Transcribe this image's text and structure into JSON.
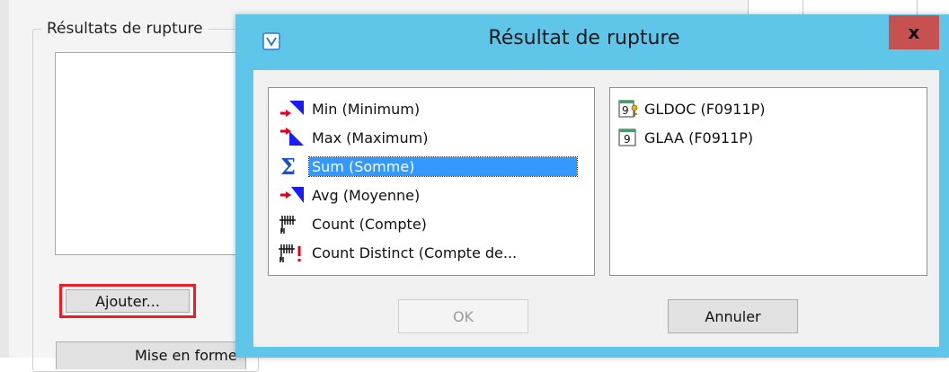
{
  "background": {
    "group_title": "Résultats de rupture",
    "add_button_label": "Ajouter...",
    "cut_button_label": "Mise en forme"
  },
  "dialog": {
    "title": "Résultat de rupture",
    "close_label": "x",
    "functions": [
      {
        "label": "Min (Minimum)",
        "icon": "min-icon"
      },
      {
        "label": "Max (Maximum)",
        "icon": "max-icon"
      },
      {
        "label": "Sum (Somme)",
        "icon": "sum-icon",
        "selected": true
      },
      {
        "label": "Avg (Moyenne)",
        "icon": "avg-icon"
      },
      {
        "label": "Count (Compte)",
        "icon": "count-icon"
      },
      {
        "label": "Count Distinct (Compte de...",
        "icon": "count-distinct-icon"
      }
    ],
    "fields": [
      {
        "label": "GLDOC (F0911P)",
        "icon": "numeric-key-field-icon",
        "badge": "9"
      },
      {
        "label": "GLAA (F0911P)",
        "icon": "numeric-field-icon",
        "badge": "9"
      }
    ],
    "ok_label": "OK",
    "cancel_label": "Annuler"
  },
  "colors": {
    "title_bar": "#5fc5e9",
    "close_button": "#c75050",
    "selection": "#3399ff",
    "highlight_border": "#ee1c24"
  }
}
